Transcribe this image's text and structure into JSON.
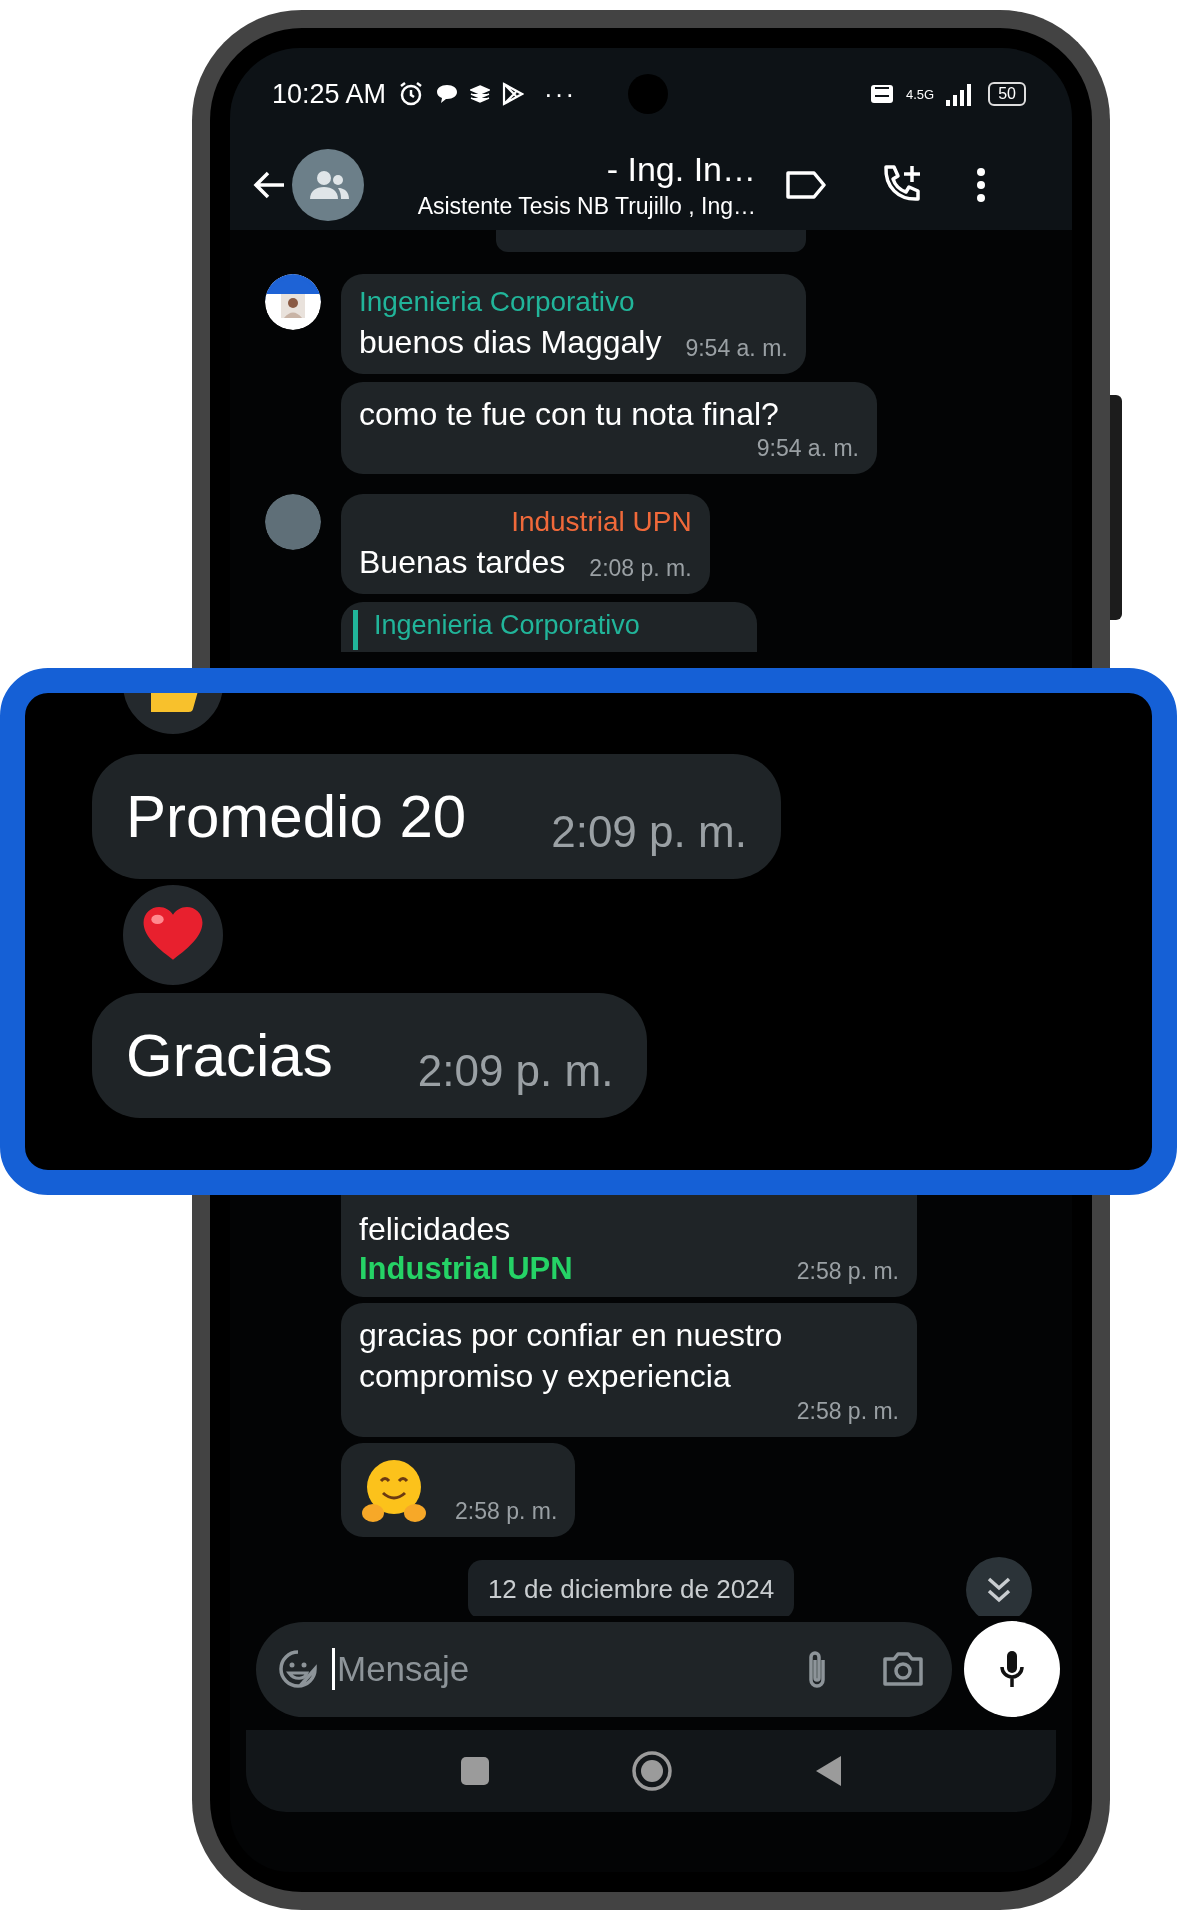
{
  "status_bar": {
    "time": "10:25 AM",
    "overflow": "···",
    "network": "4.5G",
    "battery": "50"
  },
  "header": {
    "title": "- Ing. In…",
    "subtitle": "Asistente Tesis NB Trujillo , Ing…"
  },
  "chat_top": [
    {
      "kind": "message",
      "avatar": true,
      "sender": "Ingenieria Corporativo",
      "color": "#21b59a",
      "text": "buenos dias Maggaly",
      "time": "9:54 a. m."
    },
    {
      "kind": "message",
      "text": "como te fue con tu nota final?",
      "time": "9:54 a. m."
    },
    {
      "kind": "message",
      "avatar": true,
      "sender": "Industrial UPN",
      "color": "#f0693a",
      "text": "Buenas tardes",
      "time": "2:08 p. m."
    },
    {
      "kind": "quote",
      "sender": "Ingenieria Corporativo",
      "color": "#21b59a"
    }
  ],
  "callout": [
    {
      "kind": "message",
      "text": "Promedio 20",
      "time": "2:09 p. m."
    },
    {
      "kind": "reaction"
    },
    {
      "kind": "message",
      "text": "Gracias",
      "time": "2:09 p. m."
    }
  ],
  "chat_bottom": [
    {
      "kind": "message",
      "text": "felicidades",
      "mention": "Industrial UPN",
      "time": "2:58 p. m."
    },
    {
      "kind": "message",
      "text": "gracias por confiar en nuestro compromiso y experiencia",
      "time": "2:58 p. m."
    },
    {
      "kind": "sticker",
      "time": "2:58 p. m."
    },
    {
      "kind": "date",
      "text": "12 de diciembre de 2024"
    }
  ],
  "composer": {
    "placeholder": "Mensaje"
  }
}
